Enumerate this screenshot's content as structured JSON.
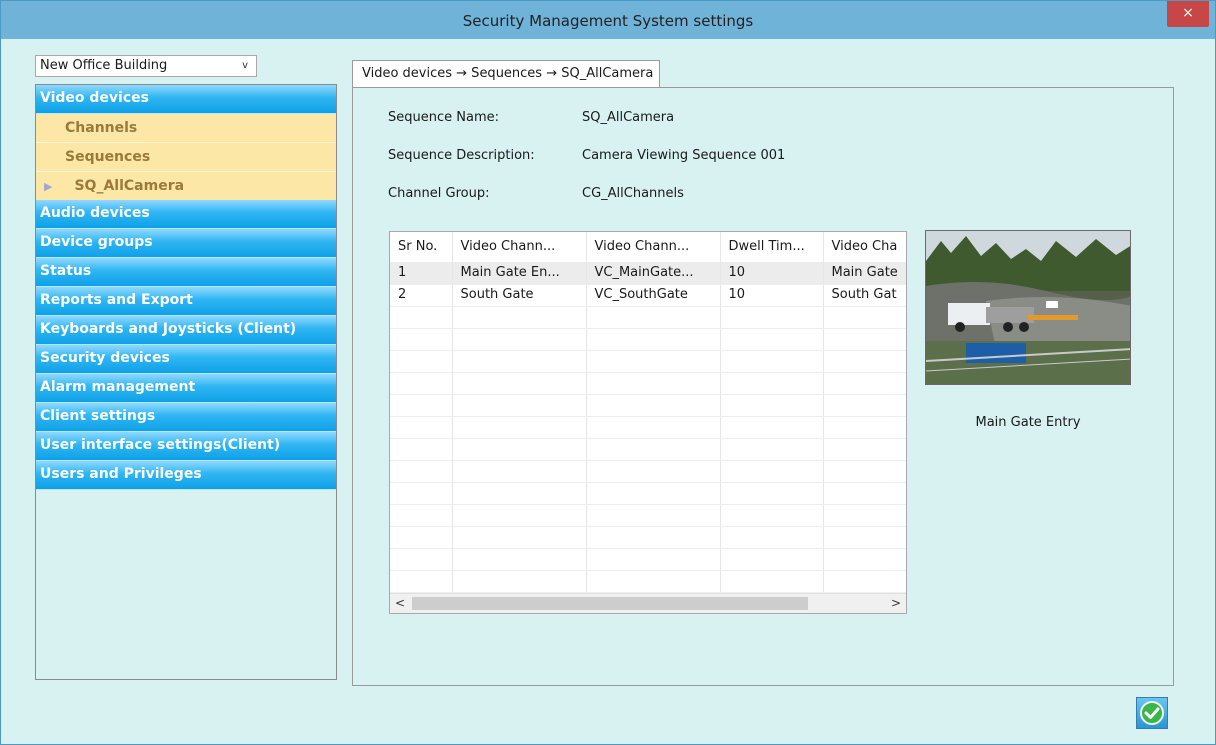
{
  "window": {
    "title": "Security Management System settings",
    "close_glyph": "×"
  },
  "building_select": {
    "value": "New Office Building",
    "chevron": "v"
  },
  "nav": {
    "video_devices": "Video devices",
    "channels": "Channels",
    "sequences": "Sequences",
    "sequence_item": "SQ_AllCamera",
    "categories": [
      "Audio devices",
      "Device groups",
      "Status",
      "Reports and Export",
      "Keyboards and Joysticks (Client)",
      "Security devices",
      "Alarm management",
      "Client settings",
      "User interface settings(Client)",
      "Users and Privileges"
    ]
  },
  "tab": {
    "label": "Video devices → Sequences → SQ_AllCamera"
  },
  "form": {
    "sequence_name_label": "Sequence Name:",
    "sequence_name_value": "SQ_AllCamera",
    "sequence_desc_label": "Sequence Description:",
    "sequence_desc_value": "Camera Viewing Sequence 001",
    "channel_group_label": "Channel Group:",
    "channel_group_value": "CG_AllChannels"
  },
  "grid": {
    "columns": [
      "Sr No.",
      "Video Chann...",
      "Video Chann...",
      "Dwell Tim...",
      "Video Cha"
    ],
    "rows": [
      [
        "1",
        "Main Gate En...",
        "VC_MainGate...",
        "10",
        "Main Gate"
      ],
      [
        "2",
        "South Gate",
        "VC_SouthGate",
        "10",
        "South Gat"
      ]
    ],
    "scroll_left": "<",
    "scroll_right": ">"
  },
  "preview": {
    "caption": "Main Gate Entry"
  },
  "colors": {
    "window_bg": "#d8f1f1",
    "titlebar": "#6fb3d9",
    "nav_category": "#0ea1e8",
    "nav_sub": "#fde7a6",
    "close": "#c74646"
  }
}
